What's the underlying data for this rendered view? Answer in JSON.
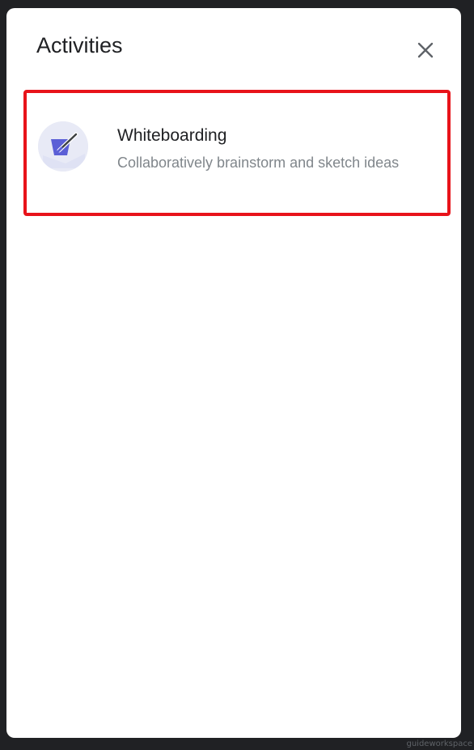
{
  "panel": {
    "title": "Activities",
    "close_icon": "close-icon"
  },
  "activities": [
    {
      "name": "Whiteboarding",
      "description": "Collaboratively brainstorm and sketch ideas",
      "icon": "whiteboard-icon"
    }
  ],
  "watermark": "guideworkspace",
  "colors": {
    "highlight_border": "#e8131a",
    "icon_accent": "#5b5fd6",
    "background": "#202124"
  }
}
